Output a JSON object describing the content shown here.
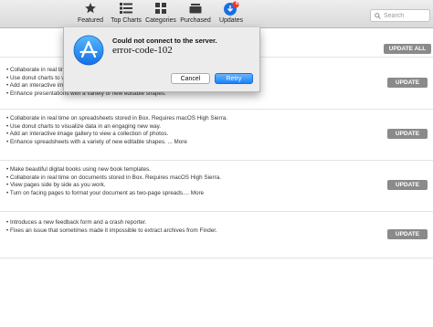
{
  "toolbar": {
    "tabs": [
      {
        "label": "Featured",
        "icon": "star-icon"
      },
      {
        "label": "Top Charts",
        "icon": "list-icon"
      },
      {
        "label": "Categories",
        "icon": "grid-icon"
      },
      {
        "label": "Purchased",
        "icon": "purchased-icon"
      },
      {
        "label": "Updates",
        "icon": "updates-icon",
        "badge": "6"
      }
    ],
    "search_placeholder": "Search"
  },
  "update_all_label": "UPDATE ALL",
  "updates": [
    {
      "notes": [
        "• Collaborate in real time on spreadsheets stored in Box. Requires macOS High Sierra.",
        "• Use donut charts to visualize data in an engaging new way.",
        "• Add an interactive image gallery to view a collection of photos.",
        "• Enhance presentations with a variety of new editable shapes."
      ],
      "button": "UPDATE"
    },
    {
      "notes": [
        "• Collaborate in real time on spreadsheets stored in Box. Requires macOS High Sierra.",
        "• Use donut charts to visualize data in an engaging new way.",
        "• Add an interactive image gallery to view a collection of photos.",
        "• Enhance spreadsheets with a variety of new editable shapes. ... More"
      ],
      "button": "UPDATE"
    },
    {
      "notes": [
        "• Make beautiful digital books using new book templates.",
        "• Collaborate in real time on documents stored in Box. Requires macOS High Sierra.",
        "• View pages side by side as you work.",
        "• Turn on facing pages to format your document as two-page spreads.... More"
      ],
      "button": "UPDATE"
    },
    {
      "notes": [
        "• Introduces a new feedback form and a crash reporter.",
        "• Fixes an issue that sometimes made it impossible to extract archives from Finder."
      ],
      "button": "UPDATE"
    }
  ],
  "dialog": {
    "title": "Could not connect to the server.",
    "code": "error-code-102",
    "cancel_label": "Cancel",
    "retry_label": "Retry",
    "icon": "app-store-icon"
  },
  "colors": {
    "accent": "#1a82fb",
    "update_button": "#8a8a8a"
  }
}
